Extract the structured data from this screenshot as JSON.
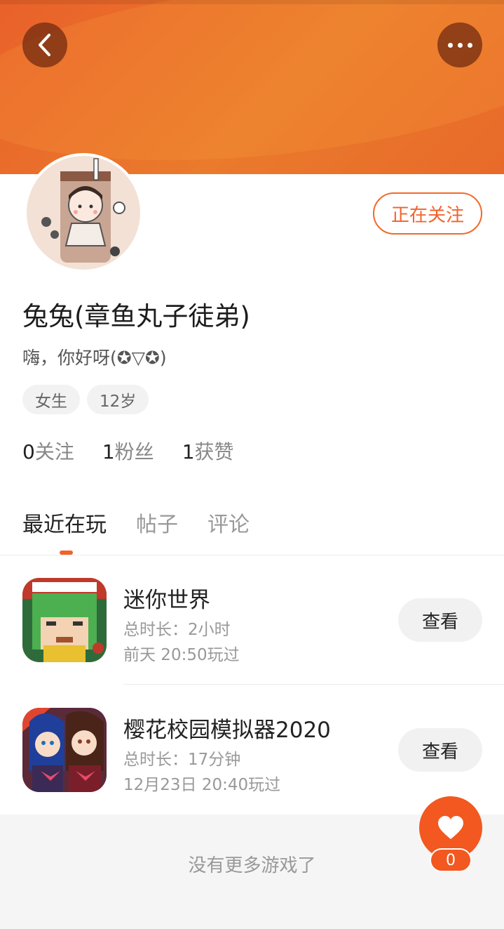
{
  "header": {
    "back_icon": "chevron-left-icon",
    "more_icon": "more-dots-icon",
    "accent": "#e9612a"
  },
  "profile": {
    "follow_label": "正在关注",
    "username": "兔兔(章鱼丸子徒弟)",
    "bio": "嗨，你好呀(✪▽✪)",
    "tags": [
      "女生",
      "12岁"
    ],
    "stats": [
      {
        "value": "0",
        "label": "关注"
      },
      {
        "value": "1",
        "label": "粉丝"
      },
      {
        "value": "1",
        "label": "获赞"
      }
    ]
  },
  "tabs": [
    {
      "label": "最近在玩",
      "active": true
    },
    {
      "label": "帖子",
      "active": false
    },
    {
      "label": "评论",
      "active": false
    }
  ],
  "games": [
    {
      "name": "迷你世界",
      "duration": "总时长：2小时",
      "last_played": "前天 20:50玩过",
      "action": "查看"
    },
    {
      "name": "樱花校园模拟器2020",
      "duration": "总时长：17分钟",
      "last_played": "12月23日 20:40玩过",
      "action": "查看"
    }
  ],
  "footer": {
    "text": "没有更多游戏了"
  },
  "like": {
    "icon": "heart-icon",
    "count": "0"
  }
}
